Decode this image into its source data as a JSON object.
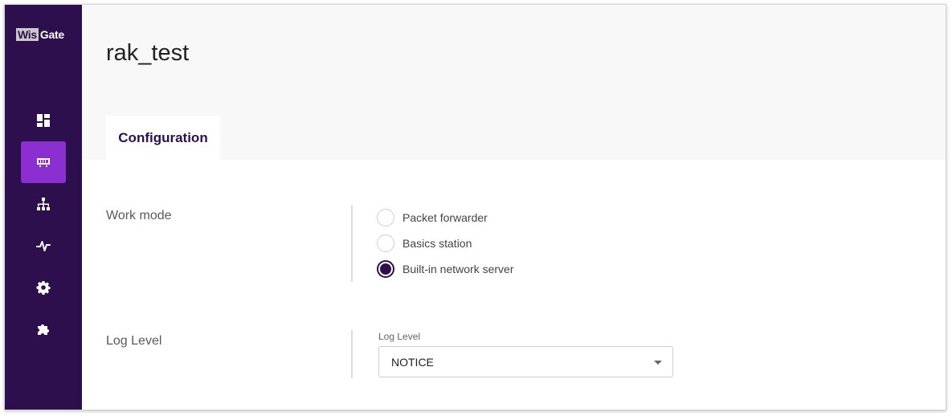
{
  "logo": {
    "box_text": "Wis",
    "text": "Gate"
  },
  "sidebar": {
    "items": [
      {
        "name": "dashboard",
        "icon": "dashboard-icon"
      },
      {
        "name": "gateway",
        "icon": "gateway-icon",
        "active": true
      },
      {
        "name": "network",
        "icon": "network-icon"
      },
      {
        "name": "monitor",
        "icon": "pulse-icon"
      },
      {
        "name": "settings",
        "icon": "gear-icon"
      },
      {
        "name": "extensions",
        "icon": "puzzle-icon"
      }
    ]
  },
  "header": {
    "title": "rak_test"
  },
  "tabs": [
    {
      "label": "Configuration",
      "active": true
    }
  ],
  "work_mode": {
    "label": "Work mode",
    "options": [
      {
        "label": "Packet forwarder",
        "checked": false
      },
      {
        "label": "Basics station",
        "checked": false
      },
      {
        "label": "Built-in network server",
        "checked": true
      }
    ]
  },
  "log_level": {
    "label": "Log Level",
    "select_caption": "Log Level",
    "value": "NOTICE"
  },
  "colors": {
    "sidebar_bg": "#2e0f4e",
    "accent": "#8b2fd1",
    "header_bg": "#f8f8f8"
  }
}
